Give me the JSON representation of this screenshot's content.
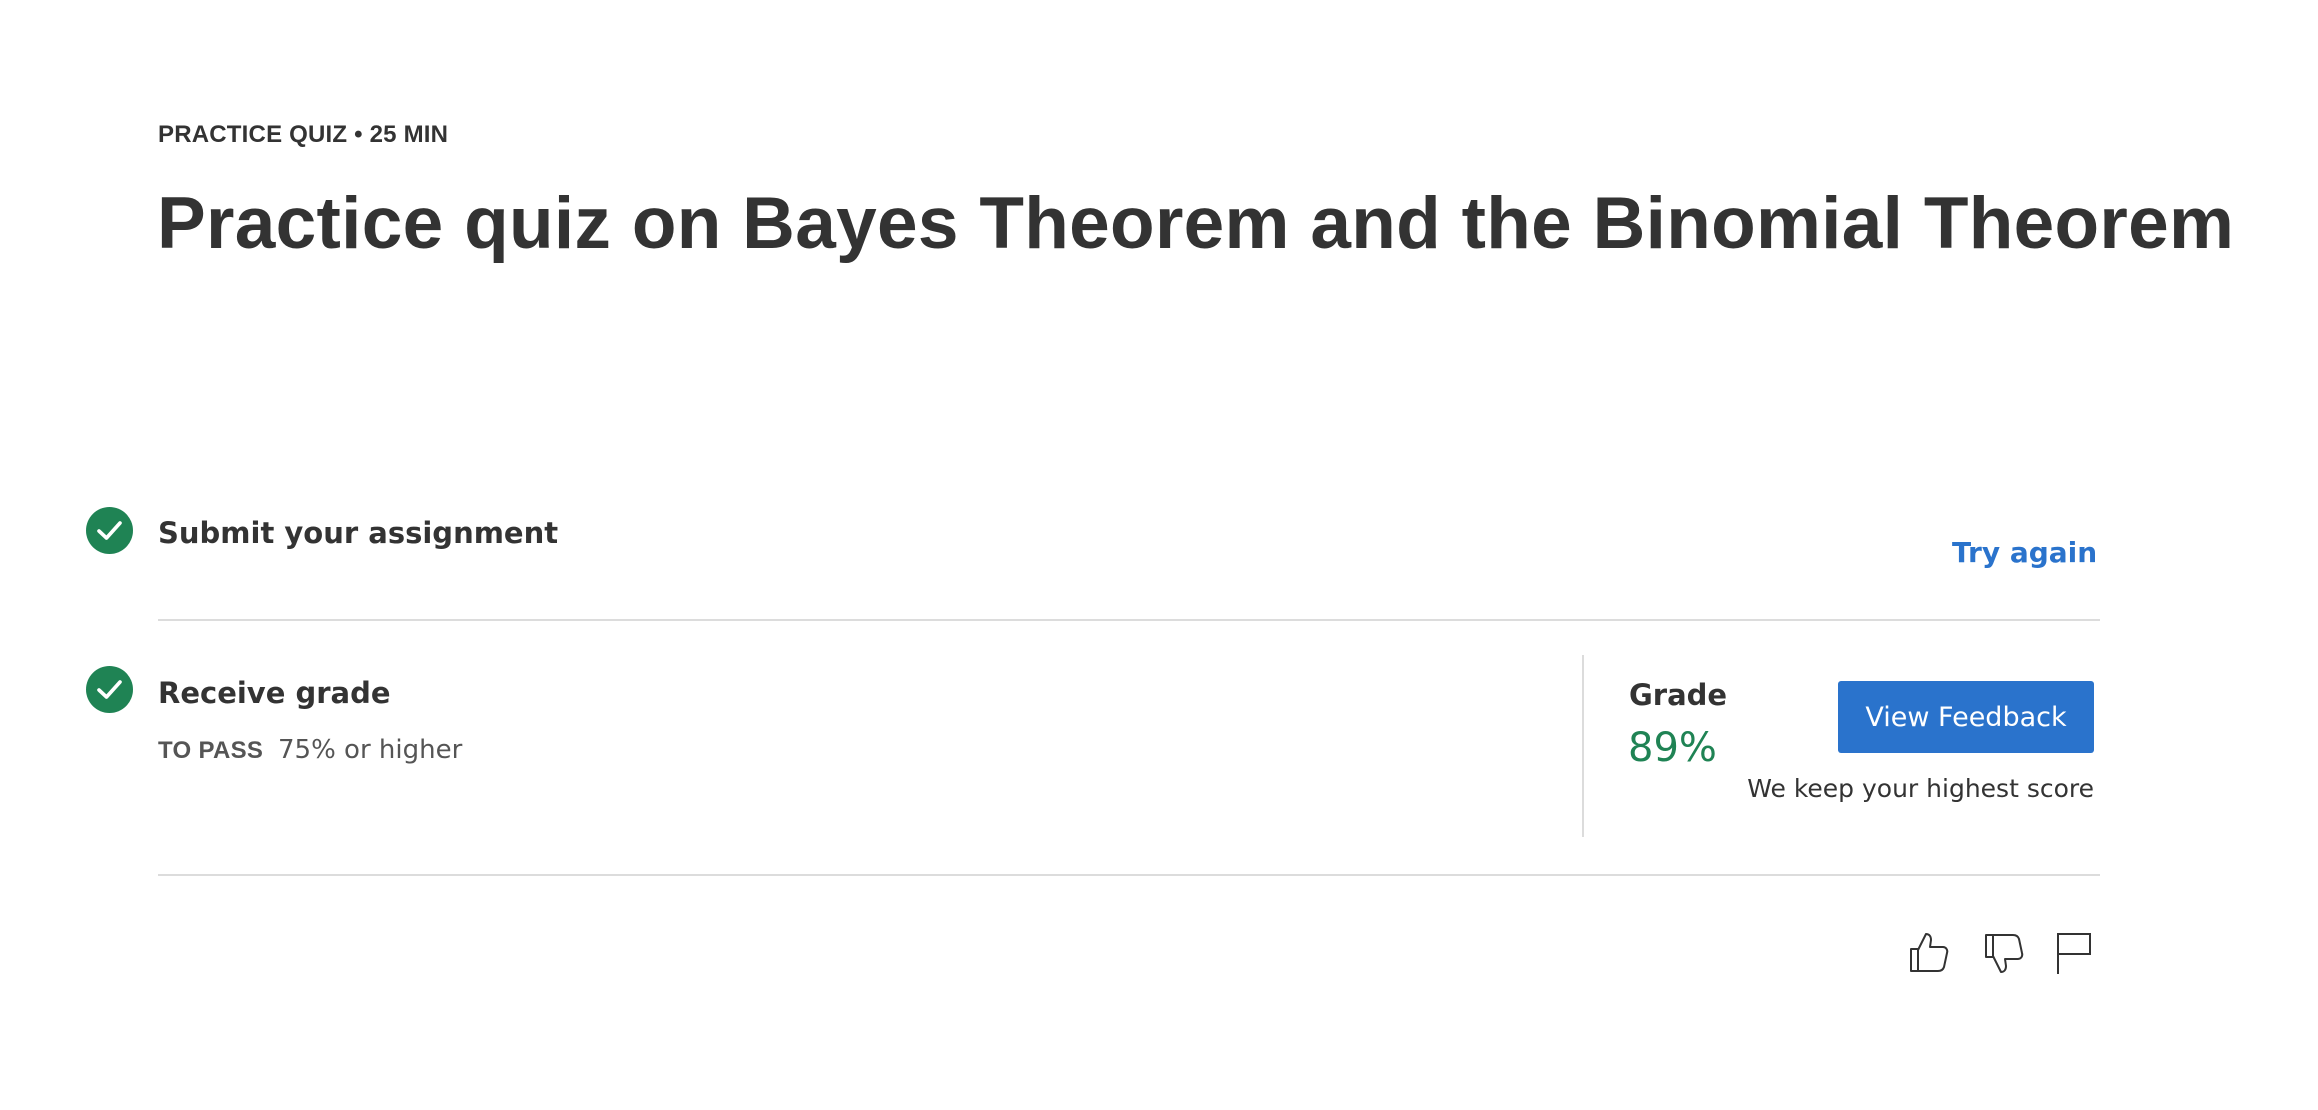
{
  "header": {
    "eyebrow": "PRACTICE QUIZ • 25 MIN",
    "title": "Practice quiz on Bayes Theorem and the Binomial Theorem"
  },
  "steps": [
    {
      "title": "Submit your assignment",
      "completed": true,
      "icon": "check-circle-icon",
      "action_label": "Try again"
    },
    {
      "title": "Receive grade",
      "completed": true,
      "icon": "check-circle-icon",
      "pass_label": "TO PASS",
      "pass_value": "75% or higher"
    }
  ],
  "grade": {
    "label": "Grade",
    "value": "89%",
    "button_label": "View Feedback",
    "note": "We keep your highest score"
  },
  "feedback_icons": [
    "thumbs-up-icon",
    "thumbs-down-icon",
    "flag-icon"
  ],
  "colors": {
    "text": "#333333",
    "success": "#1f8354",
    "link": "#2a73cc",
    "button_bg": "#2a73cc",
    "divider": "#dcdcdc"
  }
}
